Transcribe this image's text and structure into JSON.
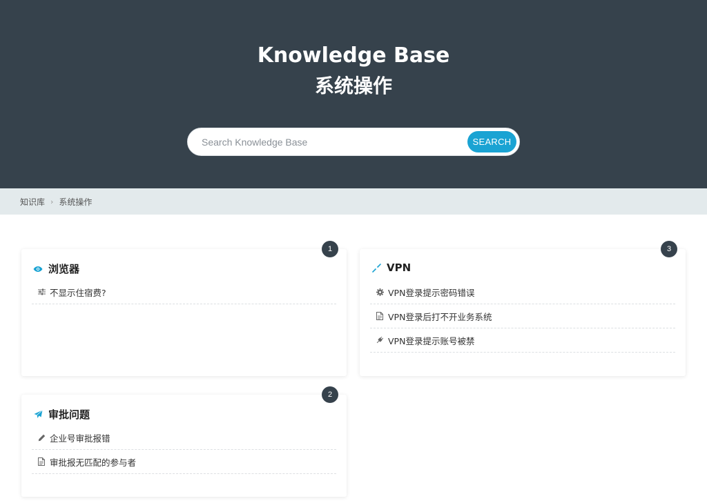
{
  "hero": {
    "title": "Knowledge Base",
    "subtitle": "系统操作"
  },
  "search": {
    "placeholder": "Search Knowledge Base",
    "button_label": "SEARCH"
  },
  "breadcrumb": {
    "root": "知识库",
    "separator": "›",
    "current": "系统操作"
  },
  "colors": {
    "hero_bg": "#36424c",
    "accent": "#1aa3d3",
    "breadcrumb_bg": "#e3eaec",
    "badge_bg": "#36424c"
  },
  "categories": [
    {
      "title": "浏览器",
      "icon": "eye-icon",
      "count": "1",
      "items": [
        {
          "label": "不显示住宿费?",
          "icon": "sliders-icon"
        }
      ]
    },
    {
      "title": "VPN",
      "icon": "compress-arrows-icon",
      "count": "3",
      "items": [
        {
          "label": "VPN登录提示密码错误",
          "icon": "gear-icon"
        },
        {
          "label": "VPN登录后打不开业务系统",
          "icon": "document-icon"
        },
        {
          "label": "VPN登录提示账号被禁",
          "icon": "plug-icon"
        }
      ]
    },
    {
      "title": "审批问题",
      "icon": "paper-plane-icon",
      "count": "2",
      "items": [
        {
          "label": "企业号审批报错",
          "icon": "pencil-icon"
        },
        {
          "label": "审批报无匹配的参与者",
          "icon": "document-icon"
        }
      ]
    }
  ]
}
